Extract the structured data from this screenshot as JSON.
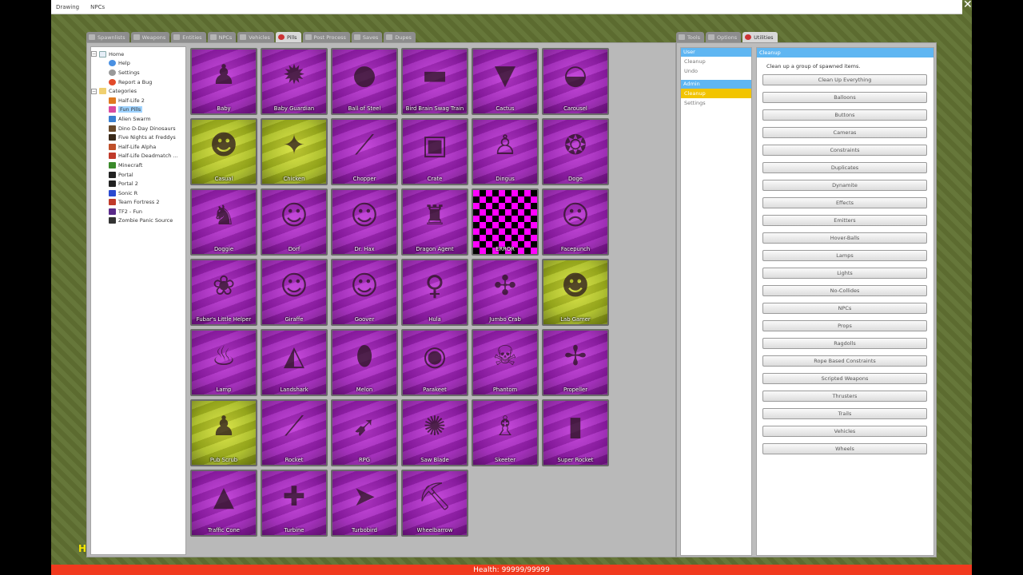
{
  "menubar": {
    "items": [
      "Drawing",
      "NPCs"
    ]
  },
  "spawn_tabs": [
    {
      "label": "Spawnlists",
      "icon": "list-icon"
    },
    {
      "label": "Weapons",
      "icon": "gun-icon"
    },
    {
      "label": "Entities",
      "icon": "box-icon"
    },
    {
      "label": "NPCs",
      "icon": "npc-icon"
    },
    {
      "label": "Vehicles",
      "icon": "car-icon"
    },
    {
      "label": "Pills",
      "icon": "pill-icon",
      "active": true
    },
    {
      "label": "Post Process",
      "icon": "image-icon"
    },
    {
      "label": "Saves",
      "icon": "save-icon"
    },
    {
      "label": "Dupes",
      "icon": "dupe-icon"
    }
  ],
  "tree": {
    "home": "Home",
    "help": "Help",
    "settings": "Settings",
    "report": "Report a Bug",
    "categories": "Categories",
    "items": [
      "Half-Life 2",
      "Fun Pills",
      "Alien Swarm",
      "Dino D-Day Dinosaurs",
      "Five Nights at Freddys",
      "Half-Life Alpha",
      "Half-Life Deadmatch ...",
      "Minecraft",
      "Portal",
      "Portal 2",
      "Sonic R",
      "Team Fortress 2",
      "TF2 - Fun",
      "Zombie Panic Source"
    ],
    "selected": "Fun Pills"
  },
  "pills": [
    {
      "name": "Baby",
      "style": "purple",
      "glyph": "♟"
    },
    {
      "name": "Baby Guardian",
      "style": "purple",
      "glyph": "✹"
    },
    {
      "name": "Ball of Steel",
      "style": "purple",
      "glyph": "●"
    },
    {
      "name": "Bird Brain Swag Train",
      "style": "purple",
      "glyph": "▬"
    },
    {
      "name": "Cactus",
      "style": "purple",
      "glyph": "▼"
    },
    {
      "name": "Carousel",
      "style": "purple",
      "glyph": "◒"
    },
    {
      "name": "Casual",
      "style": "yellow",
      "glyph": "☻"
    },
    {
      "name": "Chicken",
      "style": "yellow",
      "glyph": "✦"
    },
    {
      "name": "Chopper",
      "style": "purple",
      "glyph": "⟋"
    },
    {
      "name": "Crate",
      "style": "purple",
      "glyph": "▣"
    },
    {
      "name": "Dingus",
      "style": "purple",
      "glyph": "♙"
    },
    {
      "name": "Doge",
      "style": "purple",
      "glyph": "❂"
    },
    {
      "name": "Doggie",
      "style": "purple",
      "glyph": "♞"
    },
    {
      "name": "Dorf",
      "style": "purple",
      "glyph": "☺"
    },
    {
      "name": "Dr. Hax",
      "style": "purple",
      "glyph": "☺"
    },
    {
      "name": "Dragon Agent",
      "style": "purple",
      "glyph": "♜"
    },
    {
      "name": "ERROR",
      "style": "checker",
      "glyph": ""
    },
    {
      "name": "Facepunch",
      "style": "purple",
      "glyph": "☹"
    },
    {
      "name": "Fubar's Little Helper",
      "style": "purple",
      "glyph": "❀"
    },
    {
      "name": "Giraffe",
      "style": "purple",
      "glyph": "☺"
    },
    {
      "name": "Goover",
      "style": "purple",
      "glyph": "☺"
    },
    {
      "name": "Hula",
      "style": "purple",
      "glyph": "♀"
    },
    {
      "name": "Jumbo Crab",
      "style": "purple",
      "glyph": "✣"
    },
    {
      "name": "Lab Gamer",
      "style": "yellow",
      "glyph": "☻"
    },
    {
      "name": "Lamp",
      "style": "purple",
      "glyph": "♨"
    },
    {
      "name": "Landshark",
      "style": "purple",
      "glyph": "◭"
    },
    {
      "name": "Melon",
      "style": "purple",
      "glyph": "⬮"
    },
    {
      "name": "Parakeet",
      "style": "purple",
      "glyph": "◉"
    },
    {
      "name": "Phantom",
      "style": "purple",
      "glyph": "☠"
    },
    {
      "name": "Propeller",
      "style": "purple",
      "glyph": "✢"
    },
    {
      "name": "Pub Scrub",
      "style": "yellow",
      "glyph": "♟"
    },
    {
      "name": "Rocket",
      "style": "purple",
      "glyph": "⟋"
    },
    {
      "name": "RPG",
      "style": "purple",
      "glyph": "➹"
    },
    {
      "name": "Saw Blade",
      "style": "purple",
      "glyph": "✺"
    },
    {
      "name": "Skeeter",
      "style": "purple",
      "glyph": "♗"
    },
    {
      "name": "Super Rocket",
      "style": "purple",
      "glyph": "▮"
    },
    {
      "name": "Traffic Cone",
      "style": "purple",
      "glyph": "▲"
    },
    {
      "name": "Turbine",
      "style": "purple",
      "glyph": "✚"
    },
    {
      "name": "Turbobird",
      "style": "purple",
      "glyph": "➤"
    },
    {
      "name": "Wheelbarrow",
      "style": "purple",
      "glyph": "⛏"
    }
  ],
  "tool_tabs": [
    {
      "label": "Tools",
      "icon": "wrench-icon"
    },
    {
      "label": "Options",
      "icon": "options-icon"
    },
    {
      "label": "Utilities",
      "icon": "utilities-icon",
      "active": true
    }
  ],
  "categories": {
    "user_header": "User",
    "user_items": [
      "Cleanup",
      "Undo"
    ],
    "admin_header": "Admin",
    "admin_items": [
      "Cleanup",
      "Settings"
    ],
    "active": "Cleanup"
  },
  "cleanup": {
    "header": "Cleanup",
    "description": "Clean up a group of spawned items.",
    "buttons": [
      "Clean Up Everything",
      "Balloons",
      "Buttons",
      "Cameras",
      "Constraints",
      "Duplicates",
      "Dynamite",
      "Effects",
      "Emitters",
      "Hover-Balls",
      "Lamps",
      "Lights",
      "No-Collides",
      "NPCs",
      "Props",
      "Ragdolls",
      "Rope Based Constraints",
      "Scripted Weapons",
      "Thrusters",
      "Trails",
      "Vehicles",
      "Wheels"
    ]
  },
  "hud": {
    "health": "Health: 99999/99999",
    "corner": "H"
  },
  "colors": {
    "accent": "#5fb6f2",
    "selected": "#f2c400",
    "health": "#f13a1e"
  }
}
